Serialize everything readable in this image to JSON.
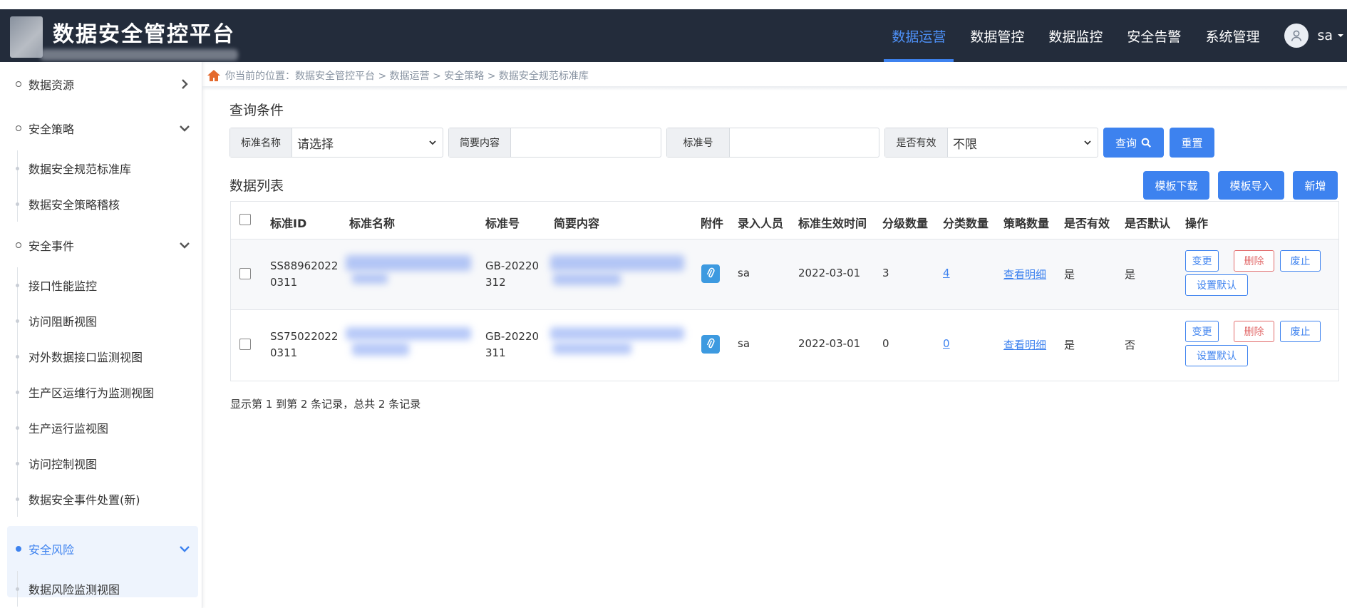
{
  "header": {
    "title": "数据安全管控平台",
    "nav": [
      "数据运营",
      "数据管控",
      "数据监控",
      "安全告警",
      "系统管理"
    ],
    "active_nav": "数据运营",
    "user": "sa",
    "active_color": "#3d82ef"
  },
  "sidebar": {
    "groups": [
      {
        "label": "数据资源",
        "icon": "chevron-right-icon",
        "items": []
      },
      {
        "label": "安全策略",
        "icon": "chevron-down-icon",
        "items": [
          "数据安全规范标准库",
          "数据安全策略稽核"
        ]
      },
      {
        "label": "安全事件",
        "icon": "chevron-down-icon",
        "items": [
          "接口性能监控",
          "访问阻断视图",
          "对外数据接口监测视图",
          "生产区运维行为监测视图",
          "生产运行监视图",
          "访问控制视图",
          "数据安全事件处置(新)"
        ]
      },
      {
        "label": "安全风险",
        "icon": "chevron-down-icon",
        "active": true,
        "items": [
          "数据风险监测视图"
        ]
      }
    ]
  },
  "breadcrumb": {
    "text": "你当前的位置：数据安全管控平台 > 数据运营 > 安全策略 > 数据安全规范标准库"
  },
  "query": {
    "title": "查询条件",
    "fields": [
      {
        "label": "标准名称",
        "type": "select",
        "value": "请选择"
      },
      {
        "label": "简要内容",
        "type": "input",
        "value": ""
      },
      {
        "label": "标准号",
        "type": "input",
        "value": ""
      },
      {
        "label": "是否有效",
        "type": "select",
        "value": "不限"
      }
    ],
    "search_label": "查询",
    "reset_label": "重置"
  },
  "list": {
    "title": "数据列表",
    "actions": [
      "模板下载",
      "模板导入",
      "新增"
    ],
    "columns": [
      "标准ID",
      "标准名称",
      "标准号",
      "简要内容",
      "附件",
      "录入人员",
      "标准生效时间",
      "分级数量",
      "分类数量",
      "策略数量",
      "是否有效",
      "是否默认",
      "操作"
    ],
    "rows": [
      {
        "id_line1": "SS88962022",
        "id_line2": "0311",
        "std_no_line1": "GB-20220",
        "std_no_line2": "312",
        "user": "sa",
        "date": "2022-03-01",
        "levels": "3",
        "classes": "4",
        "policy": "查看明细",
        "valid": "是",
        "default": "是"
      },
      {
        "id_line1": "SS75022022",
        "id_line2": "0311",
        "std_no_line1": "GB-20220",
        "std_no_line2": "311",
        "user": "sa",
        "date": "2022-03-01",
        "levels": "0",
        "classes": "0",
        "policy": "查看明细",
        "valid": "是",
        "default": "否"
      }
    ],
    "row_actions": {
      "change": "变更",
      "delete": "删除",
      "abolish": "废止",
      "set_default": "设置默认"
    },
    "summary": "显示第 1 到第 2 条记录，总共 2 条记录"
  }
}
